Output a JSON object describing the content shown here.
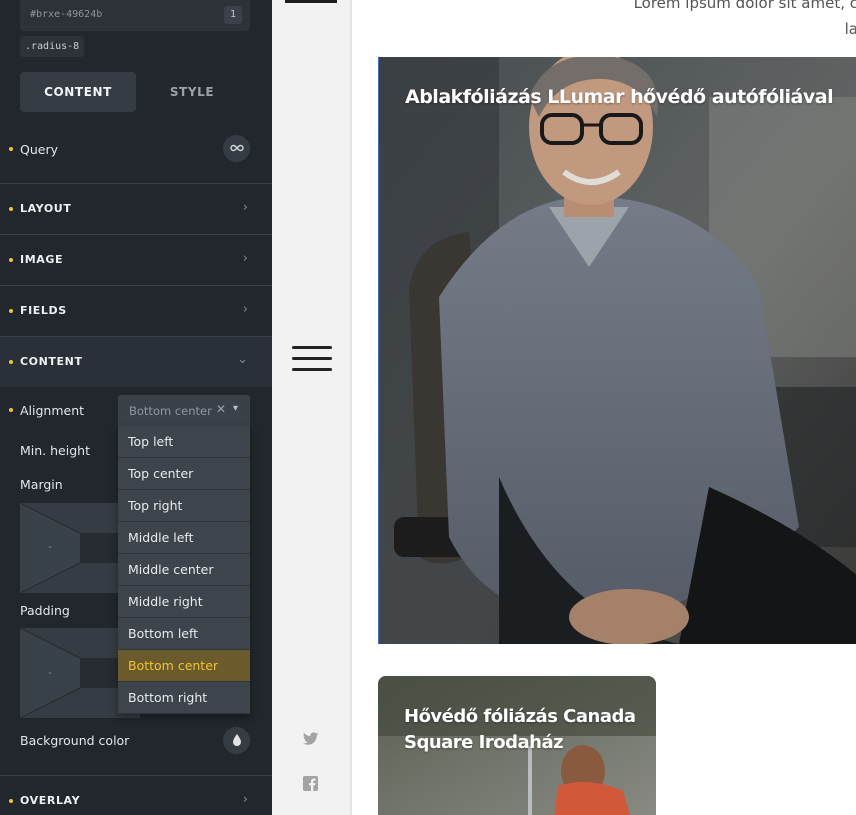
{
  "panel": {
    "element_id": "#brxe-49624b",
    "class_count": "1",
    "class_chip": ".radius-8",
    "tabs": {
      "content": "CONTENT",
      "style": "STYLE"
    },
    "query_label": "Query",
    "query_icon": "infinity-icon",
    "sections": {
      "layout": "LAYOUT",
      "image": "IMAGE",
      "fields": "FIELDS",
      "content": "CONTENT",
      "overlay": "OVERLAY"
    },
    "alignment_label": "Alignment",
    "alignment_value": "Bottom center",
    "alignment_options": [
      "Top left",
      "Top center",
      "Top right",
      "Middle left",
      "Middle center",
      "Middle right",
      "Bottom left",
      "Bottom center",
      "Bottom right"
    ],
    "min_height_label": "Min. height",
    "margin_label": "Margin",
    "padding_label": "Padding",
    "box_placeholder": "-",
    "background_color_label": "Background color",
    "background_color_icon": "droplet-icon",
    "accent_color": "#f0c331"
  },
  "strip": {
    "menu_icon": "hamburger-icon",
    "social_icons": [
      "twitter-icon",
      "facebook-icon"
    ]
  },
  "canvas": {
    "lorem_line1": "Lorem ipsum dolor sit amet, c",
    "lorem_line2": "la",
    "cards": [
      {
        "title": "Ablakfóliázás LLumar hővédő autófóliával"
      },
      {
        "title": "Hővédő fóliázás Canada Square Irodaház"
      }
    ]
  }
}
